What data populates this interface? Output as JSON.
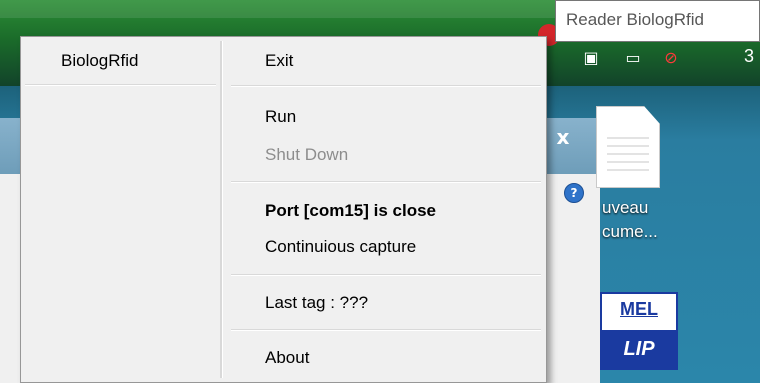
{
  "tooltip": {
    "text": "Reader BiologRfid"
  },
  "tray": {
    "clock_partial": "3"
  },
  "desktop": {
    "doc_label_line1": "uveau",
    "doc_label_line2": "cume...",
    "app_icon_top": "MEL",
    "app_icon_bottom": "LIP"
  },
  "background_window": {
    "close_glyph": "x",
    "help_glyph": "?"
  },
  "menu": {
    "title": "BiologRfid",
    "items": [
      {
        "label": "Exit",
        "state": "enabled"
      },
      {
        "label": "Run",
        "state": "enabled"
      },
      {
        "label": "Shut Down",
        "state": "disabled"
      },
      {
        "label": "Port [com15] is close",
        "state": "bold"
      },
      {
        "label": "Continuious capture",
        "state": "enabled"
      },
      {
        "label": "Last tag : ???",
        "state": "enabled"
      },
      {
        "label": "About",
        "state": "enabled"
      }
    ]
  },
  "colors": {
    "menu_bg": "#f0f0f0",
    "disabled_text": "#8d8d8d"
  }
}
